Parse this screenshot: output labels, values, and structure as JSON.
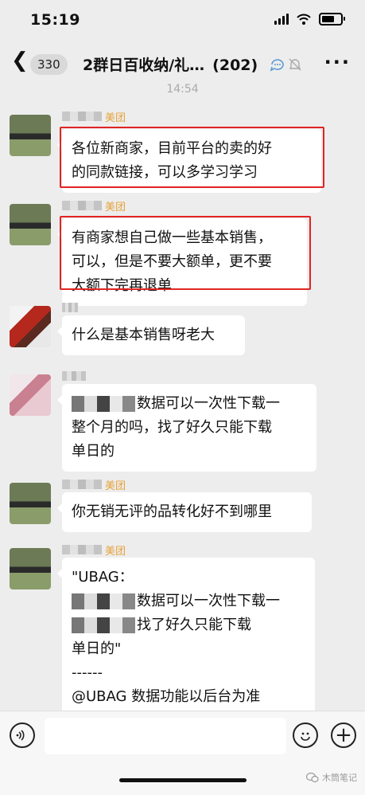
{
  "status_bar": {
    "time": "15:19"
  },
  "nav": {
    "unread_count": "330",
    "title": "2群日百收纳/礼…",
    "member_count": "(202)"
  },
  "chat": {
    "timestamp": "14:54",
    "messages": [
      {
        "tag": "美团",
        "lines": [
          "各位新商家，目前平台的卖的好",
          "的同款链接，可以多学习学习"
        ],
        "highlighted": true
      },
      {
        "tag": "美团",
        "lines": [
          "有商家想自己做一些基本销售，",
          "可以，但是不要大额单，更不要",
          "大额下完再退单"
        ],
        "highlighted": true
      },
      {
        "tag": "",
        "lines": [
          "什么是基本销售呀老大"
        ],
        "highlighted": false
      },
      {
        "tag": "",
        "lines": [
          "数据可以一次性下载一",
          "整个月的吗，找了好久只能下载",
          "单日的"
        ],
        "highlighted": false
      },
      {
        "tag": "美团",
        "lines": [
          "你无销无评的品转化好不到哪里"
        ],
        "highlighted": false
      },
      {
        "tag": "美团",
        "lines": [
          "\"UBAG：",
          "数据可以一次性下载一",
          "找了好久只能下载",
          "单日的\"",
          "------",
          "@UBAG 数据功能以后台为准"
        ],
        "highlighted": false
      }
    ]
  },
  "watermark": {
    "text": "木筒笔记"
  },
  "colors": {
    "highlight": "#e02424",
    "tag": "#e6a23c",
    "background": "#ededed"
  }
}
